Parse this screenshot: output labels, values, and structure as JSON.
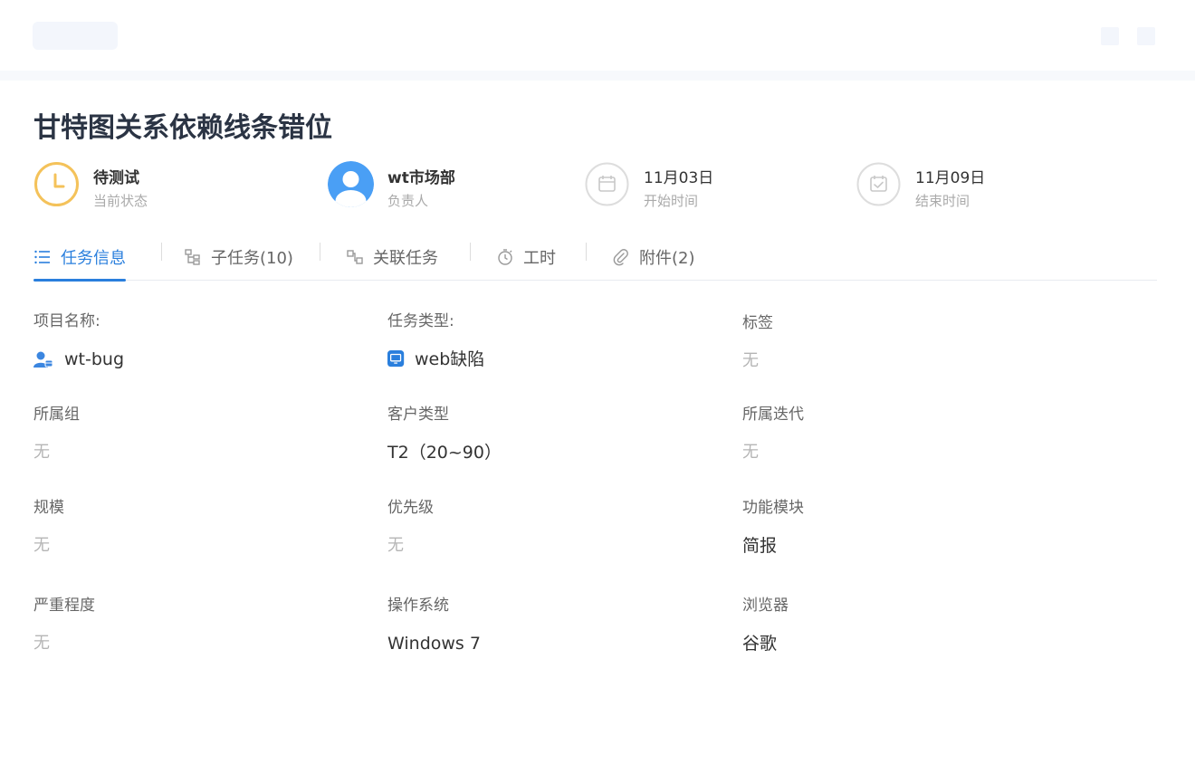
{
  "task": {
    "title": "甘特图关系依赖线条错位"
  },
  "meta": [
    {
      "value": "待测试",
      "label": "当前状态",
      "icon": "clock-icon",
      "color": "#f4c25a"
    },
    {
      "value": "wt市场部",
      "label": "负责人",
      "icon": "user-avatar-icon",
      "color": "#4a9ff5"
    },
    {
      "value": "11月03日",
      "label": "开始时间",
      "icon": "calendar-icon",
      "color": "#d6d6d6"
    },
    {
      "value": "11月09日",
      "label": "结束时间",
      "icon": "calendar-check-icon",
      "color": "#d6d6d6"
    }
  ],
  "tabs": [
    {
      "label": "任务信息",
      "icon": "list-icon",
      "active": true
    },
    {
      "label": "子任务(10)",
      "icon": "subtask-icon",
      "active": false
    },
    {
      "label": "关联任务",
      "icon": "link-task-icon",
      "active": false
    },
    {
      "label": "工时",
      "icon": "stopwatch-icon",
      "active": false
    },
    {
      "label": "附件(2)",
      "icon": "paperclip-icon",
      "active": false
    }
  ],
  "fields": {
    "project": {
      "label": "项目名称:",
      "value": "wt-bug",
      "icon": "project-user-icon"
    },
    "task_type": {
      "label": "任务类型:",
      "value": "web缺陷",
      "icon": "monitor-icon"
    },
    "tags": {
      "label": "标签",
      "value": "无"
    },
    "group": {
      "label": "所属组",
      "value": "无"
    },
    "customer_type": {
      "label": "客户类型",
      "value": "T2（20~90）"
    },
    "iteration": {
      "label": "所属迭代",
      "value": "无"
    },
    "scale": {
      "label": "规模",
      "value": "无"
    },
    "priority": {
      "label": "优先级",
      "value": "无"
    },
    "module": {
      "label": "功能模块",
      "value": "简报"
    },
    "severity": {
      "label": "严重程度",
      "value": "无"
    },
    "os": {
      "label": "操作系统",
      "value": "Windows 7"
    },
    "browser": {
      "label": "浏览器",
      "value": "谷歌"
    }
  },
  "colors": {
    "accent": "#2a7fdd",
    "status": "#f4c25a",
    "avatar": "#4a9ff5"
  }
}
